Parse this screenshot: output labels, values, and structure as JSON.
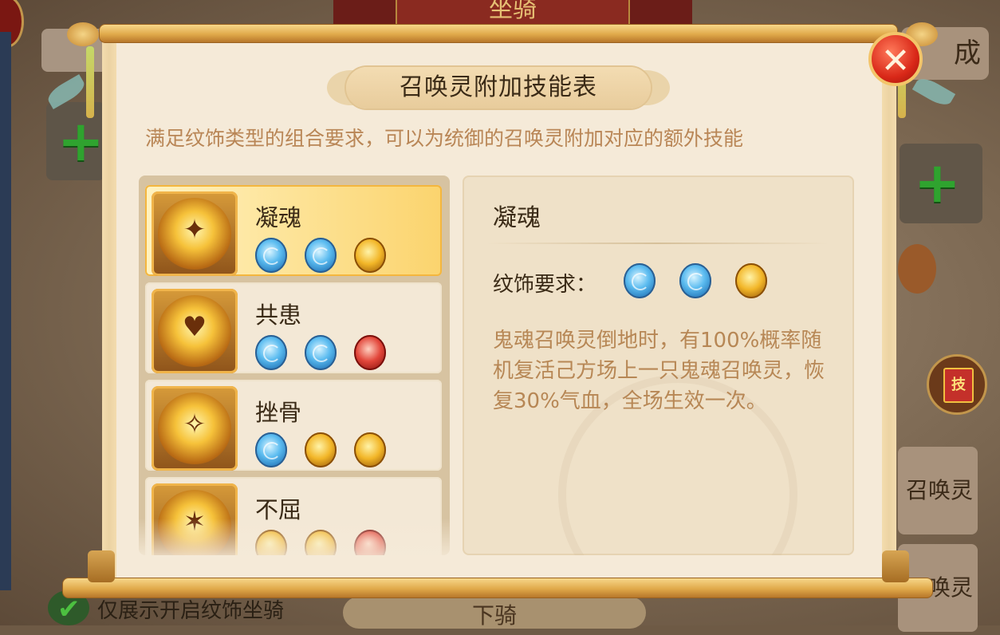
{
  "background": {
    "banner_text": "坐骑",
    "right_top_button": "成",
    "tab1_label": "召唤灵",
    "tab2_label": "召唤灵",
    "skill_book_icon_text": "技",
    "bottom_checkbox_label": "仅展示开启纹饰坐骑",
    "bottom_button": "下骑"
  },
  "dialog": {
    "title": "召唤灵附加技能表",
    "subtitle": "满足纹饰类型的组合要求，可以为统御的召唤灵附加对应的额外技能",
    "close_icon": "close-icon",
    "skills": [
      {
        "name": "凝魂",
        "gems": [
          "blue",
          "blue",
          "gold"
        ],
        "selected": true
      },
      {
        "name": "共患",
        "gems": [
          "blue",
          "blue",
          "red"
        ],
        "selected": false
      },
      {
        "name": "挫骨",
        "gems": [
          "blue",
          "gold",
          "gold"
        ],
        "selected": false
      },
      {
        "name": "不屈",
        "gems": [
          "gold",
          "gold",
          "red"
        ],
        "selected": false
      }
    ],
    "detail": {
      "name": "凝魂",
      "requirement_label": "纹饰要求：",
      "gems": [
        "blue",
        "blue",
        "gold"
      ],
      "description": "鬼魂召唤灵倒地时，有100%概率随机复活己方场上一只鬼魂召唤灵，恢复30%气血，全场生效一次。"
    }
  },
  "colors": {
    "scroll_paper": "#f5ead8",
    "selected_highlight": "#fbd46e",
    "subtitle_text": "#b98656",
    "description_text": "#b78755",
    "close_button": "#d92818"
  }
}
